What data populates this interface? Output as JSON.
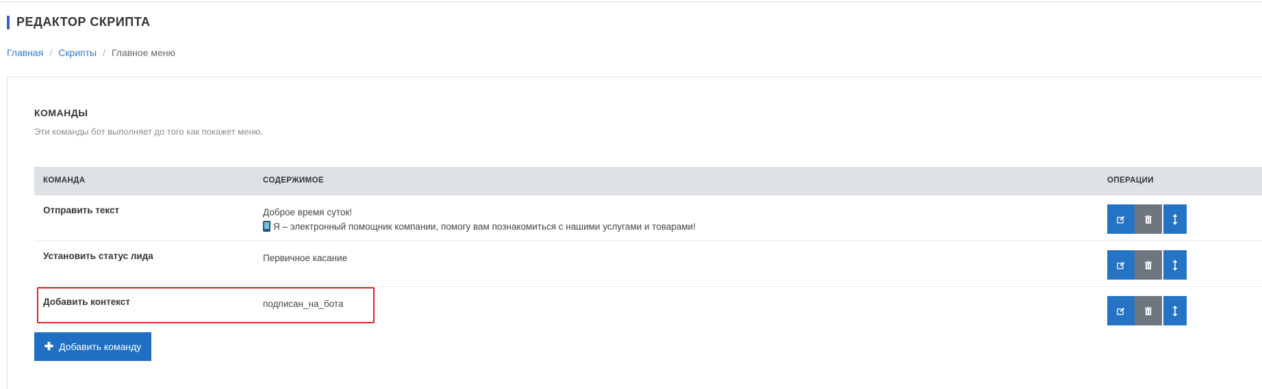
{
  "page": {
    "title": "РЕДАКТОР СКРИПТА"
  },
  "breadcrumb": {
    "home": "Главная",
    "scripts": "Скрипты",
    "current": "Главное меню",
    "separator": "/"
  },
  "commands": {
    "title": "КОМАНДЫ",
    "subtitle": "Эти команды бот выполняет до того как покажет меню.",
    "columns": {
      "command": "КОМАНДА",
      "content": "СОДЕРЖИМОЕ",
      "operations": "ОПЕРАЦИИ"
    },
    "rows": [
      {
        "command": "Отправить текст",
        "content_line1": "Доброе время суток!",
        "content_line2": "Я – электронный помощник компании, помогу вам познакомиться с нашими услугами и товарами!"
      },
      {
        "command": "Установить статус лида",
        "content_line1": "Первичное касание"
      },
      {
        "command": "Добавить контекст",
        "content_line1": "подписан_на_бота"
      }
    ],
    "add_button": "Добавить команду"
  },
  "icons": {
    "edit": "edit-icon",
    "delete": "trash-icon",
    "move": "move-vertical-icon",
    "add": "plus-icon",
    "phone": "mobile-phone-emoji"
  },
  "colors": {
    "primary": "#1f6fc5",
    "secondary": "#6e7780",
    "title_accent": "#3c5ec8",
    "highlight": "#e02020",
    "link": "#2d7ad6"
  }
}
